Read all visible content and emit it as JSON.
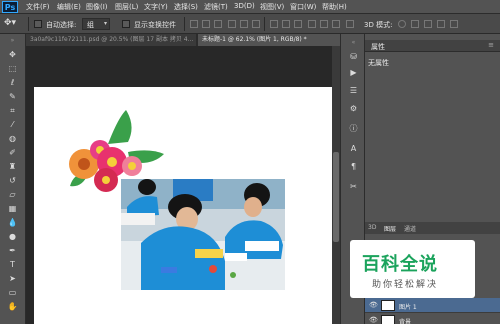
{
  "app": {
    "logo": "Ps"
  },
  "menu": [
    "文件(F)",
    "编辑(E)",
    "图像(I)",
    "图层(L)",
    "文字(Y)",
    "选择(S)",
    "滤镜(T)",
    "3D(D)",
    "视图(V)",
    "窗口(W)",
    "帮助(H)"
  ],
  "options": {
    "auto_select_label": "自动选择:",
    "auto_select_value": "组",
    "show_transform_label": "显示变换控件",
    "mode_3d_label": "3D 模式:"
  },
  "tabs": [
    {
      "label": "3a0af9c11fe72111.psd @ 20.5% (图层 17 副本 拷贝 4...",
      "active": false
    },
    {
      "label": "未标题-1 @ 62.1% (图片 1, RGB/8) *",
      "active": true
    }
  ],
  "tools": [
    "move-tool-icon",
    "marquee-tool-icon",
    "lasso-tool-icon",
    "quick-select-tool-icon",
    "crop-tool-icon",
    "eyedropper-tool-icon",
    "healing-tool-icon",
    "brush-tool-icon",
    "stamp-tool-icon",
    "history-brush-tool-icon",
    "eraser-tool-icon",
    "gradient-tool-icon",
    "blur-tool-icon",
    "dodge-tool-icon",
    "pen-tool-icon",
    "type-tool-icon",
    "path-select-tool-icon",
    "shape-tool-icon",
    "hand-tool-icon",
    "zoom-tool-icon"
  ],
  "properties": {
    "title": "属性",
    "content": "无属性"
  },
  "layers_panel": {
    "tabs": [
      "3D",
      "图层",
      "通道"
    ],
    "layers": [
      {
        "name": "图片 1",
        "selected": true
      },
      {
        "name": "背景",
        "selected": false
      }
    ]
  },
  "watermark": {
    "title": "百科全说",
    "subtitle": "助你轻松解决"
  },
  "colors": {
    "accent": "#31a8ff",
    "watermark_green": "#1ba35c",
    "shirt_blue": "#1e8ed6"
  }
}
